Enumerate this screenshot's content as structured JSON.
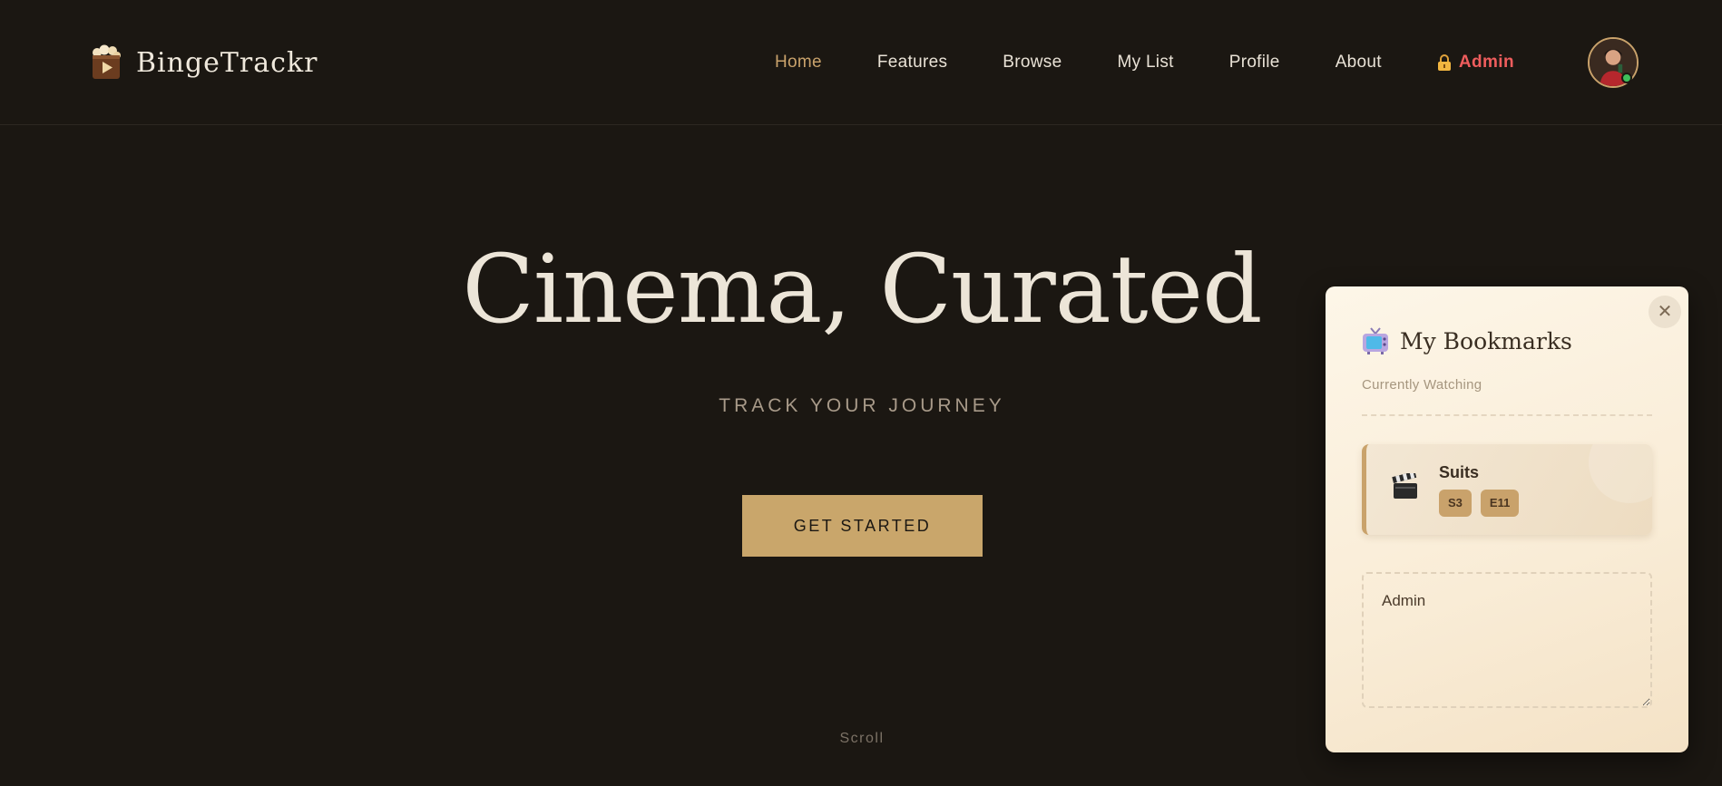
{
  "brand": {
    "name": "BingeTrackr",
    "icon": "popcorn-play-icon"
  },
  "nav": {
    "items": [
      {
        "label": "Home",
        "active": true
      },
      {
        "label": "Features"
      },
      {
        "label": "Browse"
      },
      {
        "label": "My List"
      },
      {
        "label": "Profile"
      },
      {
        "label": "About"
      }
    ],
    "admin": {
      "label": "Admin",
      "icon": "lock-icon",
      "color": "#ef5d5d"
    }
  },
  "user": {
    "avatar": "avatar-icon",
    "status": "online"
  },
  "hero": {
    "title": "Cinema, Curated",
    "subtitle": "TRACK YOUR JOURNEY",
    "cta_label": "GET STARTED",
    "scroll_label": "Scroll"
  },
  "bookmarks": {
    "title": "My Bookmarks",
    "icon": "tv-icon",
    "subtitle": "Currently Watching",
    "close_icon": "close-icon",
    "items": [
      {
        "title": "Suits",
        "icon": "clapper-board-icon",
        "season": "S3",
        "episode": "E11"
      }
    ],
    "note_value": "Admin"
  },
  "colors": {
    "background": "#1b1712",
    "accent": "#c9a66b",
    "admin": "#ef5d5d",
    "panel": "#fdf6e8"
  }
}
